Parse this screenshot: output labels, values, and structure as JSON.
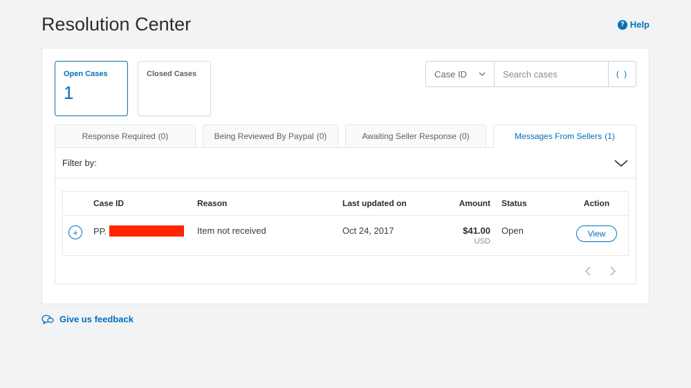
{
  "header": {
    "title": "Resolution Center",
    "help_label": "Help"
  },
  "tiles": {
    "open": {
      "label": "Open Cases",
      "count": "1"
    },
    "closed": {
      "label": "Closed Cases"
    }
  },
  "search": {
    "selector_label": "Case ID",
    "placeholder": "Search cases",
    "button_glyph": "( )"
  },
  "tabs": {
    "response_required": {
      "label": "Response Required",
      "count": "(0)"
    },
    "being_reviewed": {
      "label": "Being Reviewed By Paypal",
      "count": "(0)"
    },
    "awaiting_seller": {
      "label": "Awaiting Seller Response",
      "count": "(0)"
    },
    "messages_sellers": {
      "label": "Messages From Sellers",
      "count": "(1)"
    }
  },
  "filter_label": "Filter by:",
  "table": {
    "headers": {
      "case_id": "Case ID",
      "reason": "Reason",
      "last_updated": "Last updated on",
      "amount": "Amount",
      "status": "Status",
      "action": "Action"
    },
    "rows": [
      {
        "case_id_prefix": "PP.",
        "reason": "Item not received",
        "last_updated": "Oct 24, 2017",
        "amount": "$41.00",
        "currency": "USD",
        "status": "Open",
        "action_label": "View"
      }
    ]
  },
  "feedback_label": "Give us feedback"
}
